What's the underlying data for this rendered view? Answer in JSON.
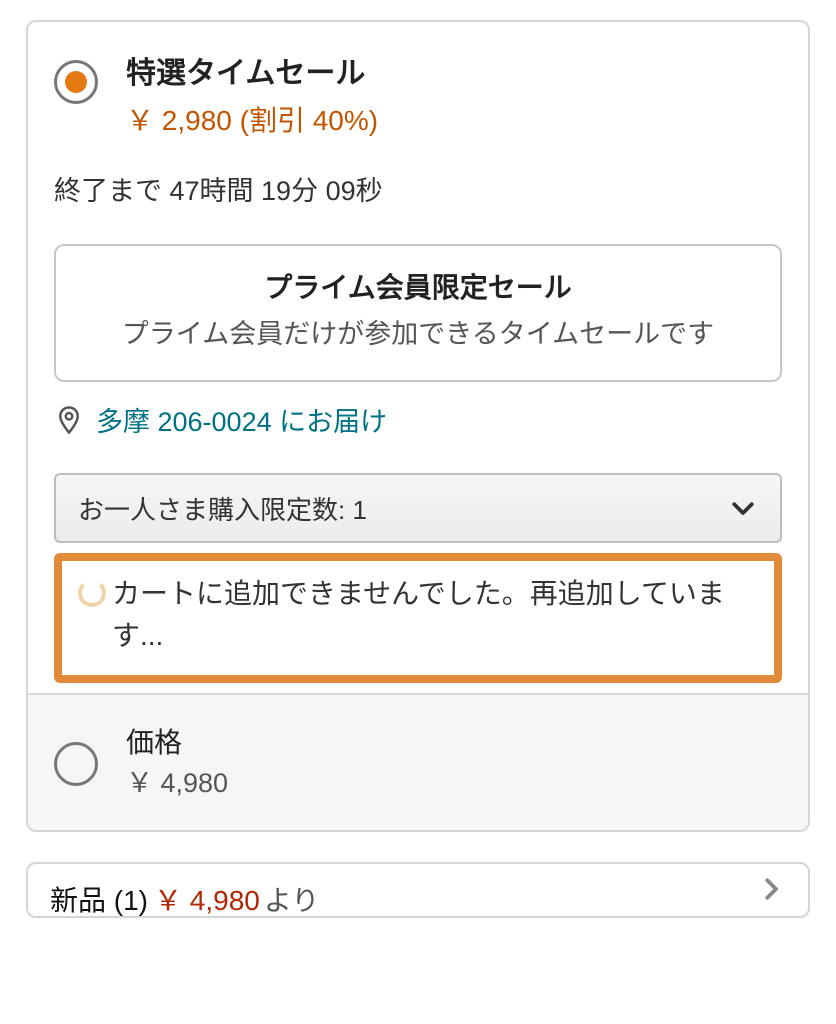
{
  "deal": {
    "title": "特選タイムセール",
    "price_line": "￥ 2,980 (割引 40%)",
    "countdown": "終了まで 47時間 19分 09秒"
  },
  "prime": {
    "title": "プライム会員限定セール",
    "desc": "プライム会員だけが参加できるタイムセールです"
  },
  "deliver": {
    "text": "多摩 206-0024 にお届け"
  },
  "qty": {
    "label": "お一人さま購入限定数:  1"
  },
  "error": {
    "text": "カートに追加できませんでした。再追加しています..."
  },
  "regular": {
    "title": "価格",
    "price": "￥ 4,980"
  },
  "bottom": {
    "lead": "新品 (1)",
    "price": "￥ 4,980",
    "suffix": "より"
  }
}
